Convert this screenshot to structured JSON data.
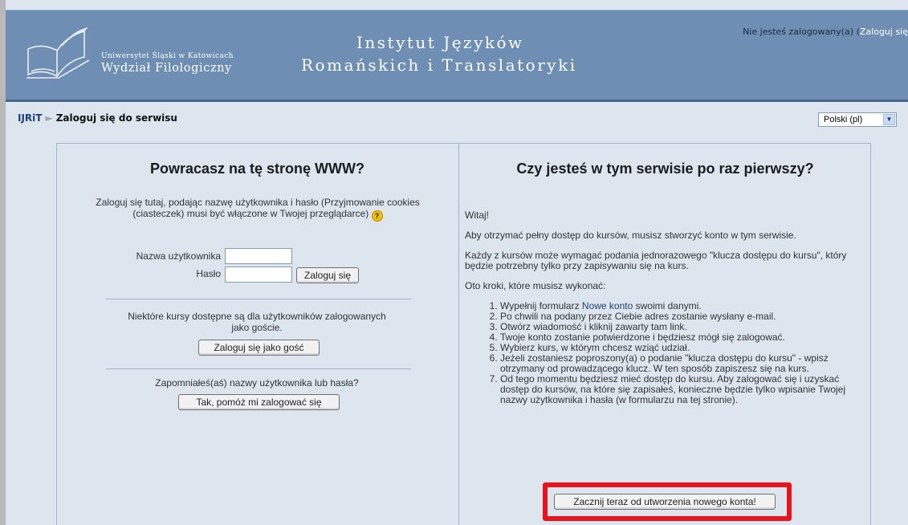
{
  "header": {
    "university": "Uniwersytet Śląski w Katowicach",
    "faculty": "Wydział Filologiczny",
    "institute_line1": "Instytut Języków",
    "institute_line2": "Romańskich i Translatoryki",
    "login_status_text": "Nie jesteś zalogowany(a) (",
    "login_link": "Zaloguj się"
  },
  "navbar": {
    "home": "IJRiT",
    "separator": "►",
    "current": "Zaloguj się do serwisu",
    "language": "Polski (pl)"
  },
  "left": {
    "title": "Powracasz na tę stronę WWW?",
    "desc": "Zaloguj się tutaj, podając nazwę użytkownika i hasło (Przyjmowanie cookies (ciasteczek) musi być włączone w Twojej przeglądarce)",
    "username_label": "Nazwa użytkownika",
    "password_label": "Hasło",
    "username_value": "",
    "password_value": "",
    "login_button": "Zaloguj się",
    "guest_desc": "Niektóre kursy dostępne są dla użytkowników zalogowanych jako goście.",
    "guest_button": "Zaloguj się jako gość",
    "forgot_desc": "Zapomniałeś(aś) nazwy użytkownika lub hasła?",
    "forgot_button": "Tak, pomóż mi zalogować się"
  },
  "right": {
    "title": "Czy jesteś w tym serwisie po raz pierwszy?",
    "greeting": "Witaj!",
    "p1": "Aby otrzymać pełny dostęp do kursów, musisz stworzyć konto w tym serwisie.",
    "p2": "Każdy z kursów może wymagać podania jednorazowego \"klucza dostępu do kursu\", który będzie potrzebny tylko przy zapisywaniu się na kurs.",
    "p3": "Oto kroki, które musisz wykonać:",
    "step1_pre": "Wypełnij formularz ",
    "step1_link": "Nowe konto",
    "step1_post": " swoimi danymi.",
    "step2": "Po chwili na podany przez Ciebie adres zostanie wysłany e-mail.",
    "step3": "Otwórz wiadomość i kliknij zawarty tam link.",
    "step4": "Twoje konto zostanie potwierdzone i będziesz mógł się zalogować.",
    "step5": "Wybierz kurs, w którym chcesz wziąć udział.",
    "step6": "Jeżeli zostaniesz poproszony(a) o podanie \"klucza dostępu do kursu\" - wpisz otrzymany od prowadzącego klucz. W ten sposób zapiszesz się na kurs.",
    "step7": "Od tego momentu będziesz mieć dostęp do kursu. Aby zalogować się i uzyskać dostęp do kursów, na które się zapisałeś, konieczne będzie tylko wpisanie Twojej nazwy użytkownika i hasła (w formularzu na tej stronie).",
    "signup_button": "Zacznij teraz od utworzenia nowego konta!"
  },
  "colors": {
    "header_bg": "#6e8fb3",
    "page_bg": "#dde6ef",
    "highlight": "#e8131b",
    "link": "#1f3f75"
  }
}
